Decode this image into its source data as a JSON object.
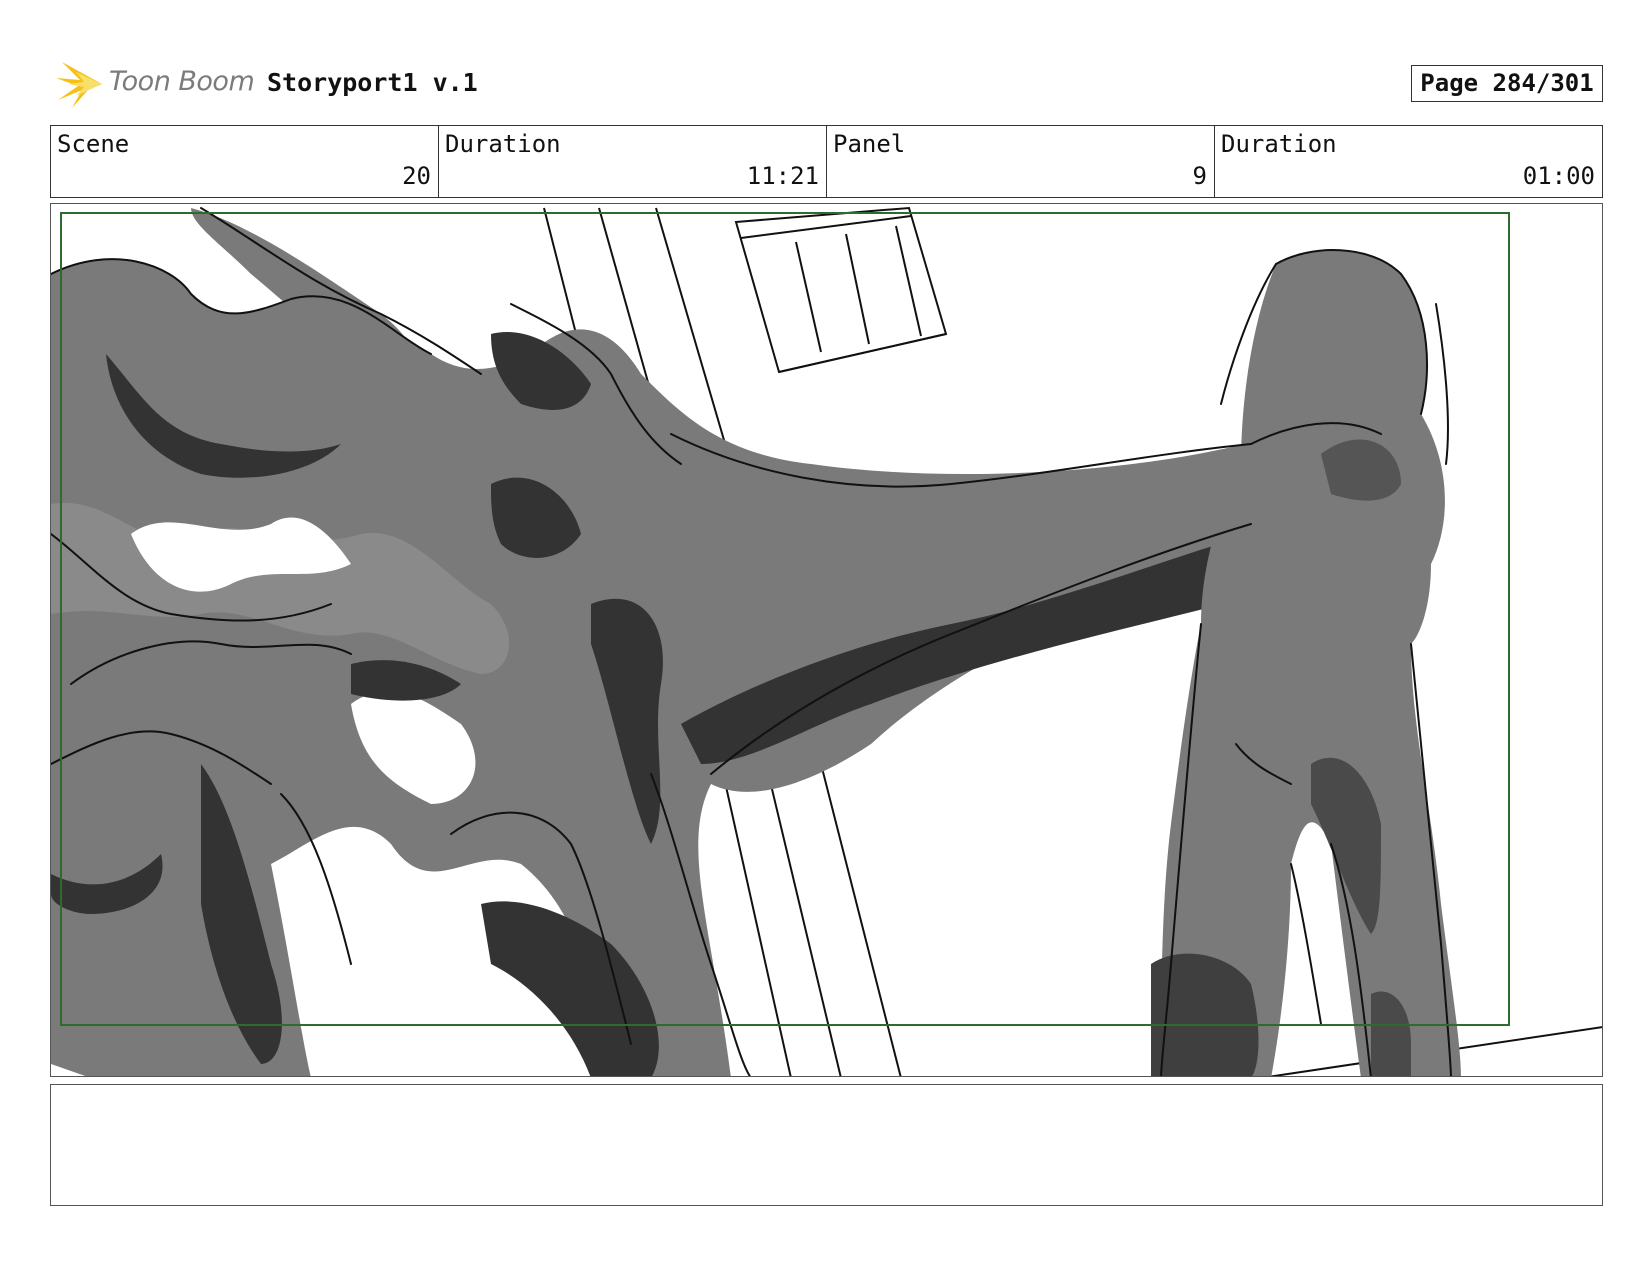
{
  "header": {
    "brand": "Toon Boom",
    "project": "Storyport1 v.1",
    "page": "Page 284/301"
  },
  "info": {
    "scene_label": "Scene",
    "scene_value": "20",
    "scene_duration_label": "Duration",
    "scene_duration_value": "11:21",
    "panel_label": "Panel",
    "panel_value": "9",
    "panel_duration_label": "Duration",
    "panel_duration_value": "01:00"
  },
  "notes": {
    "text": ""
  },
  "colors": {
    "safe_frame": "#2e6b2e",
    "mid_tone": "#7a7a7a",
    "dark_tone": "#333333",
    "logo_accent": "#f5c116"
  }
}
